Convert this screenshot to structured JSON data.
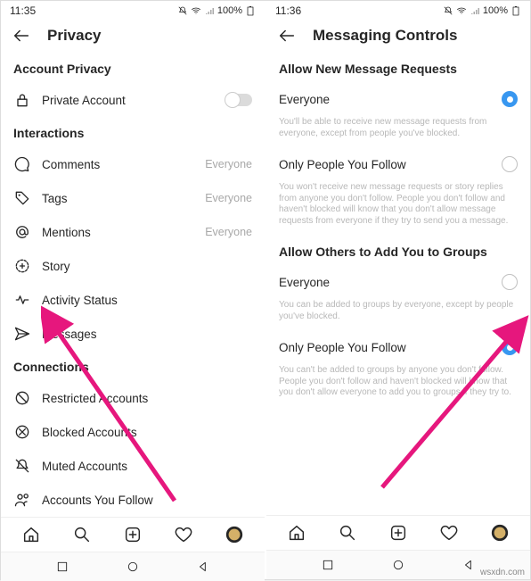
{
  "left": {
    "time": "11:35",
    "battery": "100%",
    "title": "Privacy",
    "sections": {
      "accountPrivacy": {
        "heading": "Account Privacy",
        "privateAccount": "Private Account"
      },
      "interactions": {
        "heading": "Interactions",
        "comments": {
          "label": "Comments",
          "value": "Everyone"
        },
        "tags": {
          "label": "Tags",
          "value": "Everyone"
        },
        "mentions": {
          "label": "Mentions",
          "value": "Everyone"
        },
        "story": {
          "label": "Story"
        },
        "activityStatus": {
          "label": "Activity Status"
        },
        "messages": {
          "label": "Messages"
        }
      },
      "connections": {
        "heading": "Connections",
        "restricted": "Restricted Accounts",
        "blocked": "Blocked Accounts",
        "muted": "Muted Accounts",
        "following": "Accounts You Follow"
      }
    }
  },
  "right": {
    "time": "11:36",
    "battery": "100%",
    "title": "Messaging Controls",
    "allowRequests": {
      "heading": "Allow New Message Requests",
      "everyone": "Everyone",
      "everyoneHelper": "You'll be able to receive new message requests from everyone, except from people you've blocked.",
      "onlyFollow": "Only People You Follow",
      "onlyFollowHelper": "You won't receive new message requests or story replies from anyone you don't follow. People you don't follow and haven't blocked will know that you don't allow message requests from everyone if they try to send you a message."
    },
    "allowGroups": {
      "heading": "Allow Others to Add You to Groups",
      "everyone": "Everyone",
      "everyoneHelper": "You can be added to groups by everyone, except by people you've blocked.",
      "onlyFollow": "Only People You Follow",
      "onlyFollowHelper": "You can't be added to groups by anyone you don't follow. People you don't follow and haven't blocked will know that you don't allow everyone to add you to groups if they try to."
    }
  },
  "watermark": "wsxdn.com"
}
